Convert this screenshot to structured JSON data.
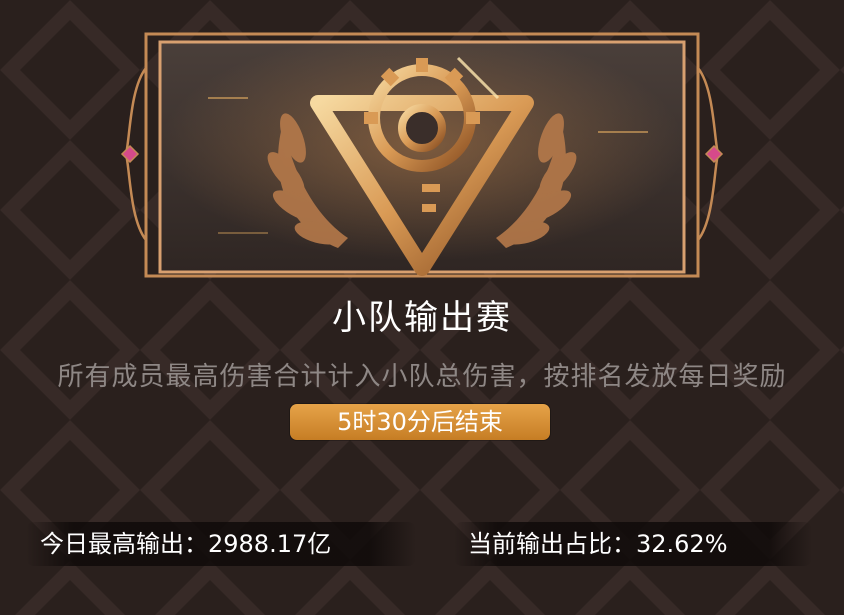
{
  "event": {
    "title": "小队输出赛",
    "description": "所有成员最高伤害合计计入小队总伤害，按排名发放每日奖励",
    "timer": "5时30分后结束"
  },
  "stats": {
    "today_best": "今日最高输出：2988.17亿",
    "current_share": "当前输出占比：32.62%"
  },
  "icons": {
    "banner_emblem": "gear-key-triangle-emblem-icon",
    "laurel_left": "laurel-left-icon",
    "laurel_right": "laurel-right-icon",
    "gem_left": "gem-left-icon",
    "gem_right": "gem-right-icon"
  },
  "colors": {
    "background": "#2a201d",
    "gold": "#e3a35c",
    "timer_bg": "#d98e35"
  }
}
